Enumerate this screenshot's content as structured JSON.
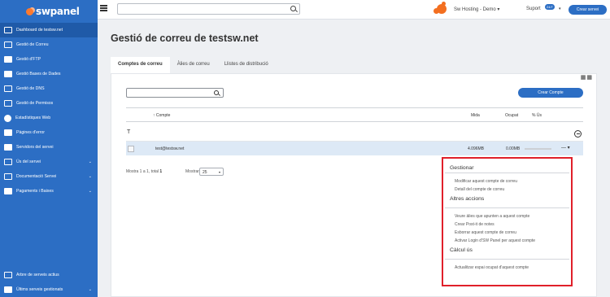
{
  "brand": {
    "name": "swpanel"
  },
  "sidebar": {
    "items": [
      {
        "label": "Dashboard de testsw.net",
        "icon": "monitor-icon"
      },
      {
        "label": "Gestió de Correu",
        "icon": "envelope-icon"
      },
      {
        "label": "Gestió d'FTP",
        "icon": "ftp-icon"
      },
      {
        "label": "Gestió Bases de Dades",
        "icon": "database-icon"
      },
      {
        "label": "Gestió de DNS",
        "icon": "flag-icon"
      },
      {
        "label": "Gestió de Permisos",
        "icon": "permissions-icon"
      },
      {
        "label": "Estadístiques Web",
        "icon": "pie-chart-icon"
      },
      {
        "label": "Pàgines d'error",
        "icon": "error-page-icon"
      },
      {
        "label": "Servidors del servei",
        "icon": "server-icon"
      },
      {
        "label": "Ús del servei",
        "icon": "usage-icon"
      },
      {
        "label": "Documentació Servei",
        "icon": "document-icon"
      },
      {
        "label": "Pagaments i Baixes",
        "icon": "payments-icon"
      }
    ],
    "bottom": [
      {
        "label": "Arbre de serveis actius",
        "icon": "tree-icon"
      },
      {
        "label": "Últims serveis gestionats",
        "icon": "recent-icon"
      }
    ]
  },
  "topbar": {
    "search_value": "",
    "account": "Sw Hosting - Demo",
    "support": "Suport",
    "support_badge": "24/7",
    "create_server": "Crear servei"
  },
  "page": {
    "title_prefix": "Gestió de correu de",
    "title_domain": "testsw.net"
  },
  "tabs": [
    {
      "label": "Comptes de correu",
      "active": true
    },
    {
      "label": "Àlies de correu",
      "active": false
    },
    {
      "label": "Llistes de distribució",
      "active": false
    }
  ],
  "list": {
    "search_value": "",
    "create_button": "Crear Compte",
    "columns": {
      "account": "Compte",
      "size": "Mida",
      "used": "Ocupat",
      "percent": "% Ús"
    },
    "filter_letter": "T",
    "rows": [
      {
        "account": "test@testsw.net",
        "size": "4.096MB",
        "used": "0.00MB"
      }
    ],
    "paging_text": "Mostra 1 a 1, total ",
    "paging_total": "1",
    "show_label": "Mostrar",
    "page_size": "25"
  },
  "dropdown": {
    "sections": [
      {
        "title": "Gestionar",
        "items": [
          "Modificar aquest compte de correu",
          "Detall del compte de correu"
        ]
      },
      {
        "title": "Altres accions",
        "items": [
          "Veure àlies que apunten a aquest compte",
          "Crear Post-it de notes",
          "Esborrar aquest compte de correu",
          "Activar Login d'SW Panel per aquest compte"
        ]
      },
      {
        "title": "Càlcul ús",
        "items": [
          "Actualitzar espai ocupat d'aquest compte"
        ]
      }
    ]
  },
  "colors": {
    "primary": "#2c6ec4",
    "brand_orange": "#f36f20",
    "highlight": "#e0202a",
    "row_selected": "#dde9f6"
  }
}
